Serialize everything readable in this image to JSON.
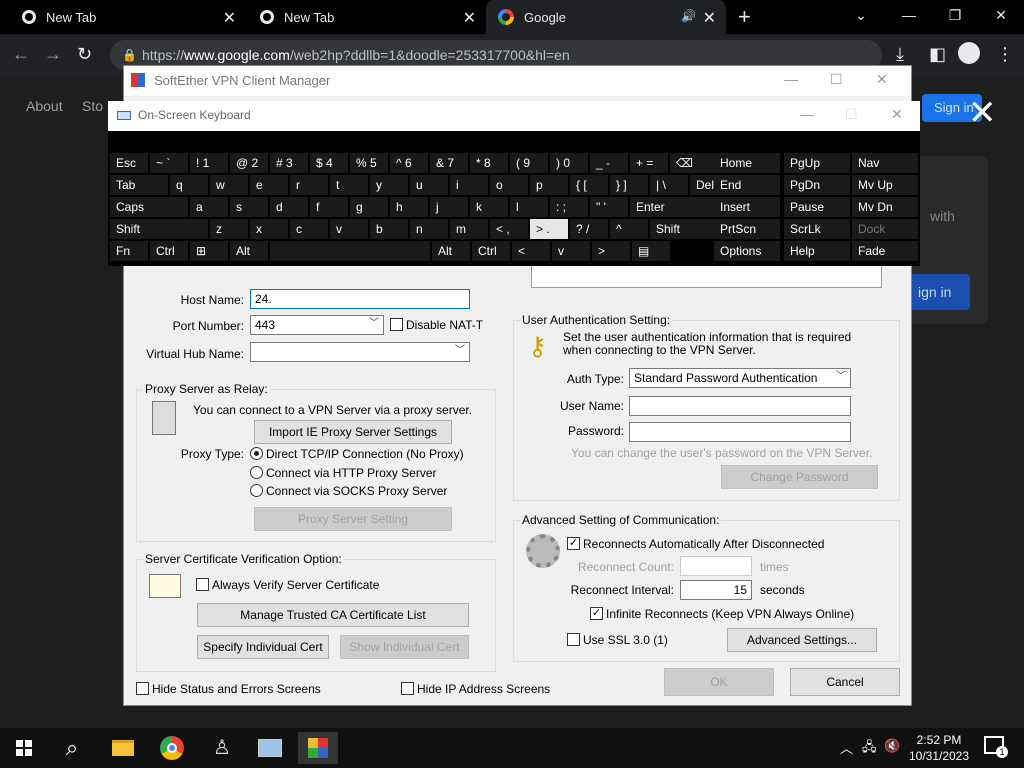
{
  "browser": {
    "tabs": [
      {
        "title": "New Tab"
      },
      {
        "title": "New Tab"
      },
      {
        "title": "Google"
      }
    ],
    "url_prefix": "https://",
    "url_domain": "www.google.com",
    "url_path": "/web2hp?ddllb=1&doodle=253317700&hl=en"
  },
  "google_page": {
    "links": [
      "About",
      "Sto"
    ],
    "sign_in": "Sign in",
    "side_text": "with",
    "sign_in_btn": "ign in"
  },
  "vpn": {
    "title": "SoftEther VPN Client Manager",
    "host_name_label": "Host Name:",
    "host_name_value": "24.",
    "port_label": "Port Number:",
    "port_value": "443",
    "disable_nat": "Disable NAT-T",
    "hub_label": "Virtual Hub Name:",
    "hub_value": "",
    "proxy": {
      "legend": "Proxy Server as Relay:",
      "desc": "You can connect to a VPN Server via a proxy server.",
      "import_btn": "Import IE Proxy Server Settings",
      "type_label": "Proxy Type:",
      "opt_direct": "Direct TCP/IP Connection (No Proxy)",
      "opt_http": "Connect via HTTP Proxy Server",
      "opt_socks": "Connect via SOCKS Proxy Server",
      "setting_btn": "Proxy Server Setting"
    },
    "cert": {
      "legend": "Server Certificate Verification Option:",
      "always_verify": "Always Verify Server Certificate",
      "manage_btn": "Manage Trusted CA Certificate List",
      "specify_btn": "Specify Individual Cert",
      "show_btn": "Show Individual Cert"
    },
    "hide_status": "Hide Status and Errors Screens",
    "hide_ip": "Hide IP Address Screens",
    "auth": {
      "legend": "User Authentication Setting:",
      "desc": "Set the user authentication information that is required when connecting to the VPN Server.",
      "type_label": "Auth Type:",
      "type_value": "Standard Password Authentication",
      "user_label": "User Name:",
      "user_value": "",
      "pass_label": "Password:",
      "pass_value": "",
      "hint": "You can change the user's password on the VPN Server.",
      "change_btn": "Change Password"
    },
    "adv": {
      "legend": "Advanced Setting of Communication:",
      "reconnect_auto": "Reconnects Automatically After Disconnected",
      "count_label": "Reconnect Count:",
      "count_unit": "times",
      "interval_label": "Reconnect Interval:",
      "interval_value": "15",
      "interval_unit": "seconds",
      "infinite": "Infinite Reconnects (Keep VPN Always Online)",
      "ssl": "Use SSL 3.0 (1)",
      "adv_btn": "Advanced Settings..."
    },
    "ok": "OK",
    "cancel": "Cancel"
  },
  "osk": {
    "title": "On-Screen Keyboard",
    "rows": [
      [
        "Esc",
        "~ `",
        "! 1",
        "@ 2",
        "# 3",
        "$ 4",
        "% 5",
        "^ 6",
        "& 7",
        "* 8",
        "( 9",
        ") 0",
        "_ -",
        "+ =",
        "⌫"
      ],
      [
        "Tab",
        "q",
        "w",
        "e",
        "r",
        "t",
        "y",
        "u",
        "i",
        "o",
        "p",
        "{ [",
        "} ]",
        "| \\",
        "Del"
      ],
      [
        "Caps",
        "a",
        "s",
        "d",
        "f",
        "g",
        "h",
        "j",
        "k",
        "l",
        ": ;",
        "\" '",
        "Enter"
      ],
      [
        "Shift",
        "z",
        "x",
        "c",
        "v",
        "b",
        "n",
        "m",
        "< ,",
        "> .",
        "? /",
        "^",
        "Shift"
      ],
      [
        "Fn",
        "Ctrl",
        "⊞",
        "Alt",
        "",
        "Alt",
        "Ctrl",
        "<",
        "v",
        ">",
        "▤"
      ]
    ],
    "nav": [
      [
        "Home",
        "PgUp",
        "Nav"
      ],
      [
        "End",
        "PgDn",
        "Mv Up"
      ],
      [
        "Insert",
        "Pause",
        "Mv Dn"
      ],
      [
        "PrtScn",
        "ScrLk",
        "Dock"
      ],
      [
        "Options",
        "Help",
        "Fade"
      ]
    ]
  },
  "taskbar": {
    "time": "2:52 PM",
    "date": "10/31/2023",
    "notif_count": "1"
  }
}
